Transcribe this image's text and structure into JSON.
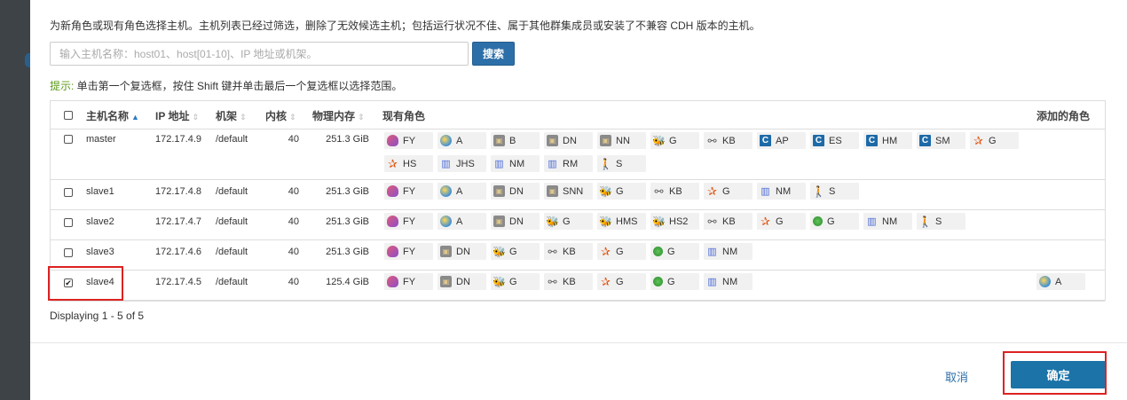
{
  "dialog": {
    "description": "为新角色或现有角色选择主机。主机列表已经过筛选，删除了无效候选主机；包括运行状况不佳、属于其他群集成员或安装了不兼容 CDH 版本的主机。",
    "search": {
      "placeholder": "输入主机名称：host01、host[01-10]、IP 地址或机架。",
      "value": "",
      "button_label": "搜索"
    },
    "hint": {
      "keyword": "提示:",
      "text": " 单击第一个复选框，按住 Shift 键并单击最后一个复选框以选择范围。"
    },
    "table": {
      "columns": {
        "host_name": "主机名称",
        "ip": "IP 地址",
        "rack": "机架",
        "cores": "内核",
        "memory": "物理内存",
        "existing_roles": "现有角色",
        "added_roles": "添加的角色"
      },
      "rows": [
        {
          "checked": false,
          "host": "master",
          "ip": "172.17.4.9",
          "rack": "/default",
          "cores": "40",
          "memory": "251.3 GiB",
          "roles": [
            {
              "icon": "fy",
              "label": "FY"
            },
            {
              "icon": "a",
              "label": "A"
            },
            {
              "icon": "hdfs",
              "label": "B"
            },
            {
              "icon": "hdfs",
              "label": "DN"
            },
            {
              "icon": "hdfs",
              "label": "NN"
            },
            {
              "icon": "hive",
              "label": "G"
            },
            {
              "icon": "kb",
              "label": "KB"
            },
            {
              "icon": "c",
              "label": "AP"
            },
            {
              "icon": "c",
              "label": "ES"
            },
            {
              "icon": "c",
              "label": "HM"
            },
            {
              "icon": "c",
              "label": "SM"
            },
            {
              "icon": "star",
              "label": "G"
            },
            {
              "icon": "star",
              "label": "HS"
            },
            {
              "icon": "yarn",
              "label": "JHS"
            },
            {
              "icon": "yarn",
              "label": "NM"
            },
            {
              "icon": "yarn",
              "label": "RM"
            },
            {
              "icon": "sqoop",
              "label": "S"
            }
          ],
          "added": []
        },
        {
          "checked": false,
          "host": "slave1",
          "ip": "172.17.4.8",
          "rack": "/default",
          "cores": "40",
          "memory": "251.3 GiB",
          "roles": [
            {
              "icon": "fy",
              "label": "FY"
            },
            {
              "icon": "a",
              "label": "A"
            },
            {
              "icon": "hdfs",
              "label": "DN"
            },
            {
              "icon": "hdfs",
              "label": "SNN"
            },
            {
              "icon": "hive",
              "label": "G"
            },
            {
              "icon": "kb",
              "label": "KB"
            },
            {
              "icon": "star",
              "label": "G"
            },
            {
              "icon": "yarn",
              "label": "NM"
            },
            {
              "icon": "sqoop",
              "label": "S"
            }
          ],
          "added": []
        },
        {
          "checked": false,
          "host": "slave2",
          "ip": "172.17.4.7",
          "rack": "/default",
          "cores": "40",
          "memory": "251.3 GiB",
          "roles": [
            {
              "icon": "fy",
              "label": "FY"
            },
            {
              "icon": "a",
              "label": "A"
            },
            {
              "icon": "hdfs",
              "label": "DN"
            },
            {
              "icon": "hive",
              "label": "G"
            },
            {
              "icon": "hive",
              "label": "HMS"
            },
            {
              "icon": "hive",
              "label": "HS2"
            },
            {
              "icon": "kb",
              "label": "KB"
            },
            {
              "icon": "star",
              "label": "G"
            },
            {
              "icon": "green",
              "label": "G"
            },
            {
              "icon": "yarn",
              "label": "NM"
            },
            {
              "icon": "sqoop",
              "label": "S"
            }
          ],
          "added": []
        },
        {
          "checked": false,
          "host": "slave3",
          "ip": "172.17.4.6",
          "rack": "/default",
          "cores": "40",
          "memory": "251.3 GiB",
          "roles": [
            {
              "icon": "fy",
              "label": "FY"
            },
            {
              "icon": "hdfs",
              "label": "DN"
            },
            {
              "icon": "hive",
              "label": "G"
            },
            {
              "icon": "kb",
              "label": "KB"
            },
            {
              "icon": "star",
              "label": "G"
            },
            {
              "icon": "green",
              "label": "G"
            },
            {
              "icon": "yarn",
              "label": "NM"
            }
          ],
          "added": []
        },
        {
          "checked": true,
          "host": "slave4",
          "ip": "172.17.4.5",
          "rack": "/default",
          "cores": "40",
          "memory": "125.4 GiB",
          "roles": [
            {
              "icon": "fy",
              "label": "FY"
            },
            {
              "icon": "hdfs",
              "label": "DN"
            },
            {
              "icon": "hive",
              "label": "G"
            },
            {
              "icon": "kb",
              "label": "KB"
            },
            {
              "icon": "star",
              "label": "G"
            },
            {
              "icon": "green",
              "label": "G"
            },
            {
              "icon": "yarn",
              "label": "NM"
            }
          ],
          "added": [
            {
              "icon": "a",
              "label": "A"
            }
          ]
        }
      ]
    },
    "status": "Displaying 1 - 5 of 5",
    "footer": {
      "cancel_label": "取消",
      "ok_label": "确定"
    }
  }
}
